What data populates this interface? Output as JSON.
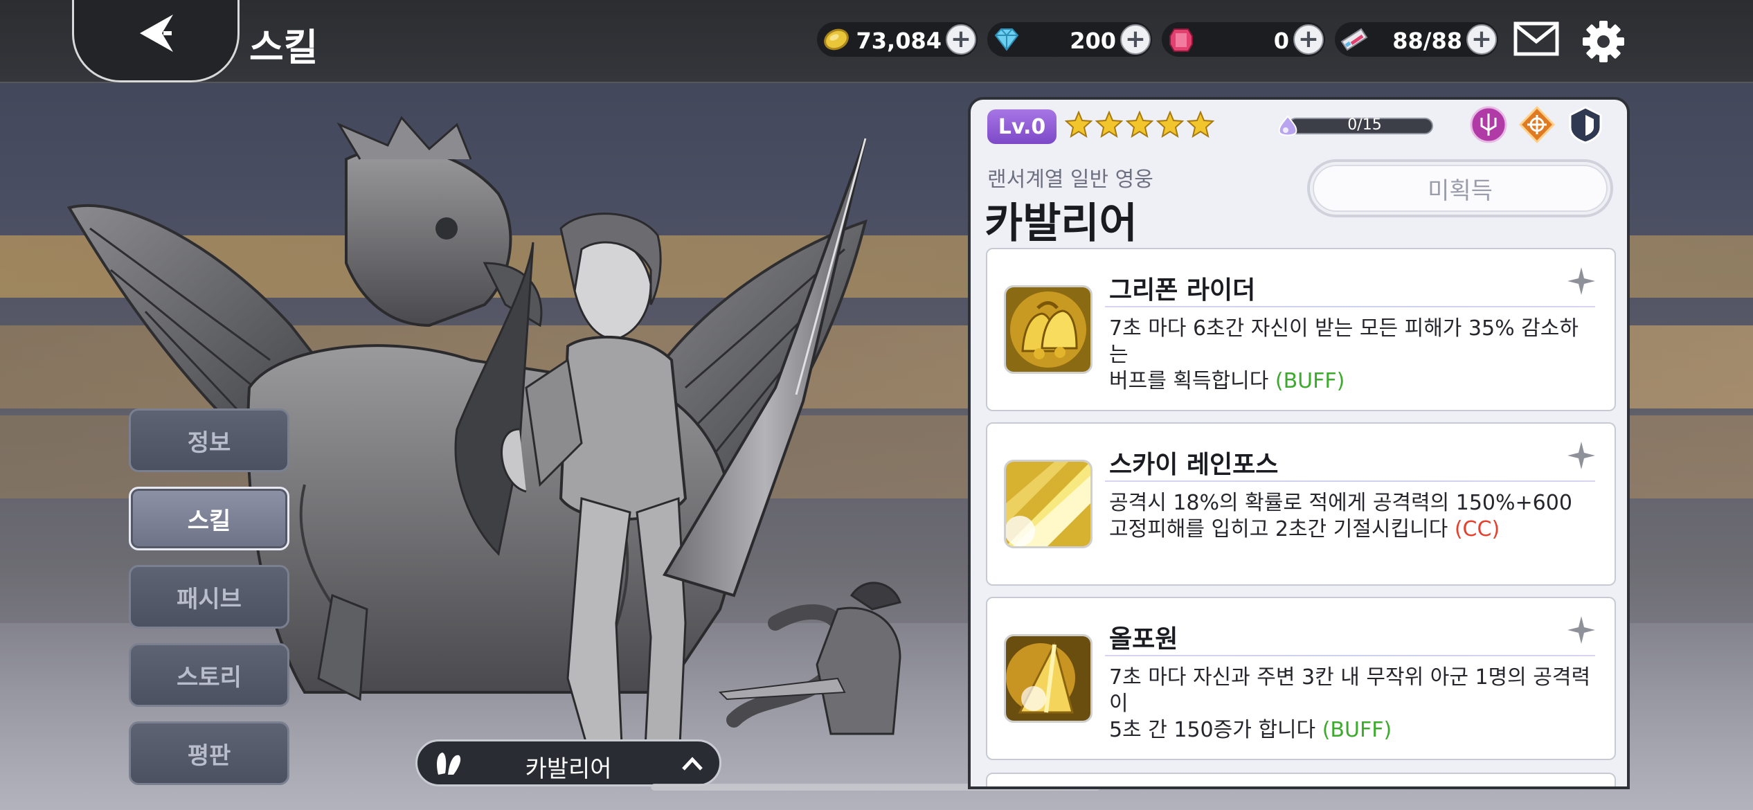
{
  "header": {
    "title": "스킬",
    "back_icon": "back-arrow-icon",
    "currencies": [
      {
        "name": "gold",
        "icon": "gold-coin-icon",
        "amount": "73,084"
      },
      {
        "name": "diamond",
        "icon": "diamond-icon",
        "amount": "200"
      },
      {
        "name": "ruby",
        "icon": "ruby-icon",
        "amount": "0"
      },
      {
        "name": "stamina",
        "icon": "ticket-icon",
        "amount": "88/88"
      }
    ],
    "mail_icon": "mail-icon",
    "settings_icon": "gear-icon"
  },
  "side_tabs": [
    {
      "label": "정보",
      "active": false
    },
    {
      "label": "스킬",
      "active": true
    },
    {
      "label": "패시브",
      "active": false
    },
    {
      "label": "스토리",
      "active": false
    },
    {
      "label": "평판",
      "active": false
    }
  ],
  "hero_selector": {
    "name": "카발리어",
    "icon": "bunny-ears-icon",
    "toggle_icon": "chevron-up-icon"
  },
  "panel": {
    "level": "Lv.0",
    "stars": 5,
    "progress": {
      "text": "0/15",
      "fraction": 0.0
    },
    "class_icons": [
      "trident-icon",
      "sun-emblem-icon",
      "shield-icon"
    ],
    "subtitle": "랜서계열 일반 영웅",
    "hero_name": "카발리어",
    "status_button": "미획득",
    "skills": [
      {
        "name": "그리폰 라이더",
        "icon": "golden-bells-icon",
        "desc": "7초 마다 6초간 자신이 받는 모든 피해가 35% 감소하는",
        "desc2": "버프를 획득합니다 ",
        "tag": "(BUFF)",
        "tag_color": "#3caa2d"
      },
      {
        "name": "스카이 레인포스",
        "icon": "light-burst-icon",
        "desc": "공격시 18%의 확률로 적에게 공격력의 150%+600",
        "desc2": "고정피해를 입히고 2초간 기절시킵니다 ",
        "tag": "(CC)",
        "tag_color": "#e3402e"
      },
      {
        "name": "올포원",
        "icon": "golden-spear-icon",
        "desc": "7초 마다 자신과 주변 3칸 내 무작위 아군 1명의 공격력이",
        "desc2": "5초 간 150증가 합니다 ",
        "tag": "(BUFF)",
        "tag_color": "#3caa2d"
      }
    ]
  },
  "colors": {
    "accent_purple": "#8a55d3",
    "buff_green": "#3caa2d",
    "cc_red": "#e3402e",
    "topbar": "#2b2d31"
  }
}
